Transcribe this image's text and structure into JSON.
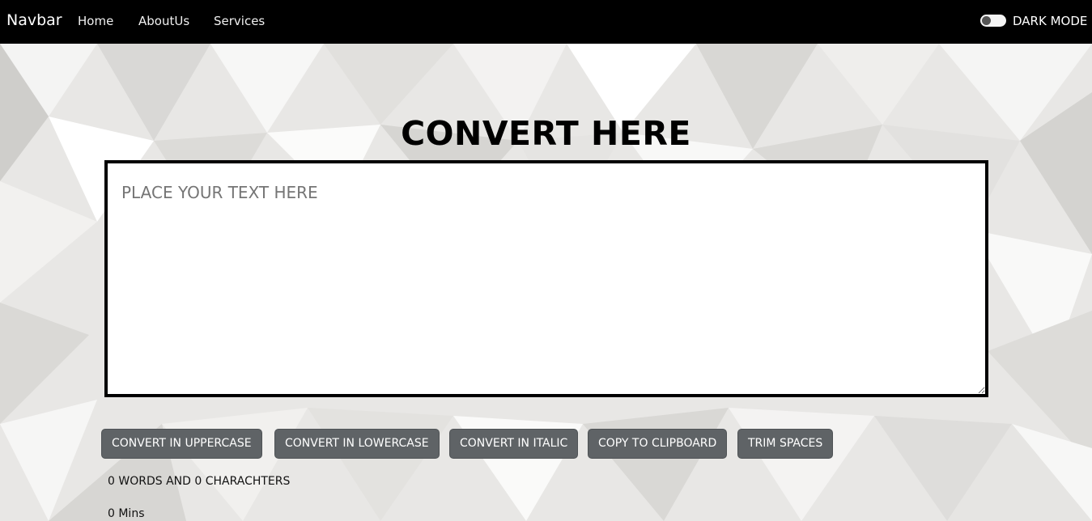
{
  "navbar": {
    "brand": "Navbar",
    "links": [
      "Home",
      "AboutUs",
      "Services"
    ],
    "dark_mode_label": "DARK MODE"
  },
  "main": {
    "title": "CONVERT HERE",
    "textarea_placeholder": "PLACE YOUR TEXT HERE",
    "textarea_value": "",
    "buttons": [
      "CONVERT IN UPPERCASE",
      "CONVERT IN LOWERCASE",
      "CONVERT IN ITALIC",
      "COPY TO CLIPBOARD",
      "TRIM SPACES"
    ],
    "summary": "0 WORDS AND 0 CHARACHTERS",
    "read_time": "0 Mins"
  },
  "colors": {
    "navbar_bg": "#000000",
    "button_bg": "#5f6366",
    "background": "#e9e8e6"
  }
}
